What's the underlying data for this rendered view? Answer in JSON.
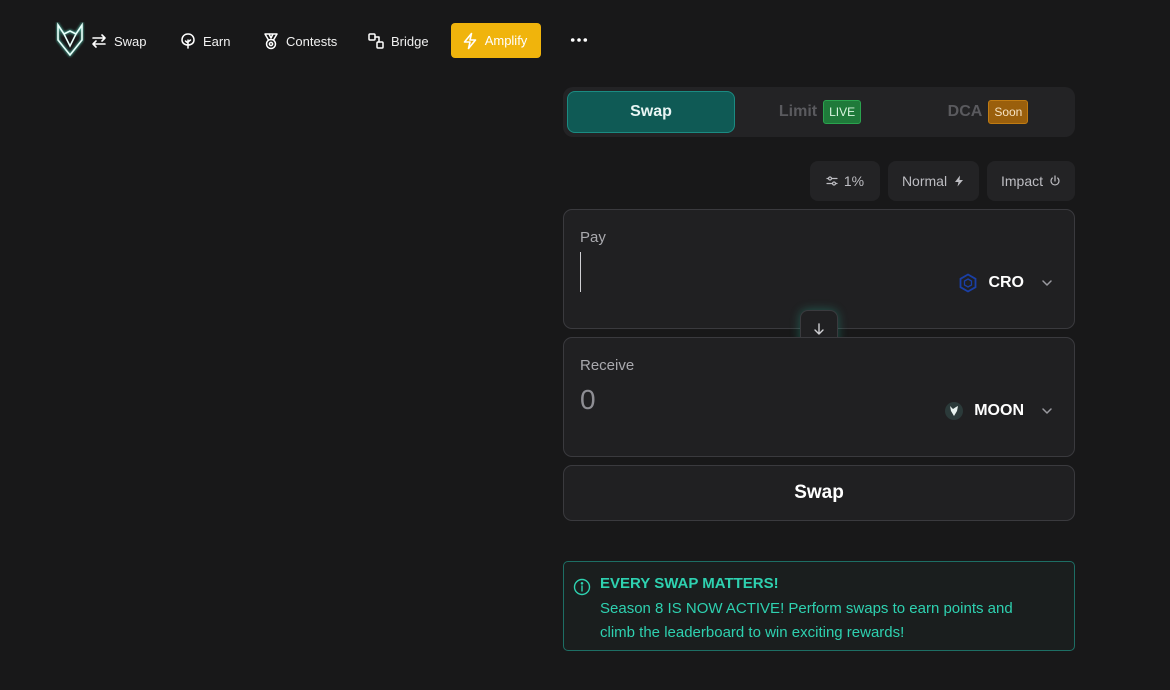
{
  "nav": {
    "items": [
      {
        "label": "Swap",
        "icon": "swap-arrows-icon"
      },
      {
        "label": "Earn",
        "icon": "tree-icon"
      },
      {
        "label": "Contests",
        "icon": "medal-icon"
      },
      {
        "label": "Bridge",
        "icon": "bridge-icon"
      },
      {
        "label": "Amplify",
        "icon": "lightning-icon"
      }
    ],
    "more_icon": "more-dots-icon",
    "amplify_color": "#f0b40c"
  },
  "tabs": {
    "swap": "Swap",
    "limit": "Limit",
    "limit_badge": "LIVE",
    "dca": "DCA",
    "dca_badge": "Soon"
  },
  "settings": {
    "slippage": "1%",
    "speed": "Normal",
    "impact": "Impact"
  },
  "pay": {
    "label": "Pay",
    "value": "",
    "token": "CRO"
  },
  "receive": {
    "label": "Receive",
    "value": "0",
    "token": "MOON"
  },
  "swap_button": "Swap",
  "notice": {
    "title": "EVERY SWAP MATTERS!",
    "body": "Season 8 IS NOW ACTIVE! Perform swaps to earn points and climb the leaderboard to win exciting rewards!"
  },
  "colors": {
    "accent": "#1b8b82",
    "notice_text": "#2ed1b0",
    "background": "#181819"
  }
}
